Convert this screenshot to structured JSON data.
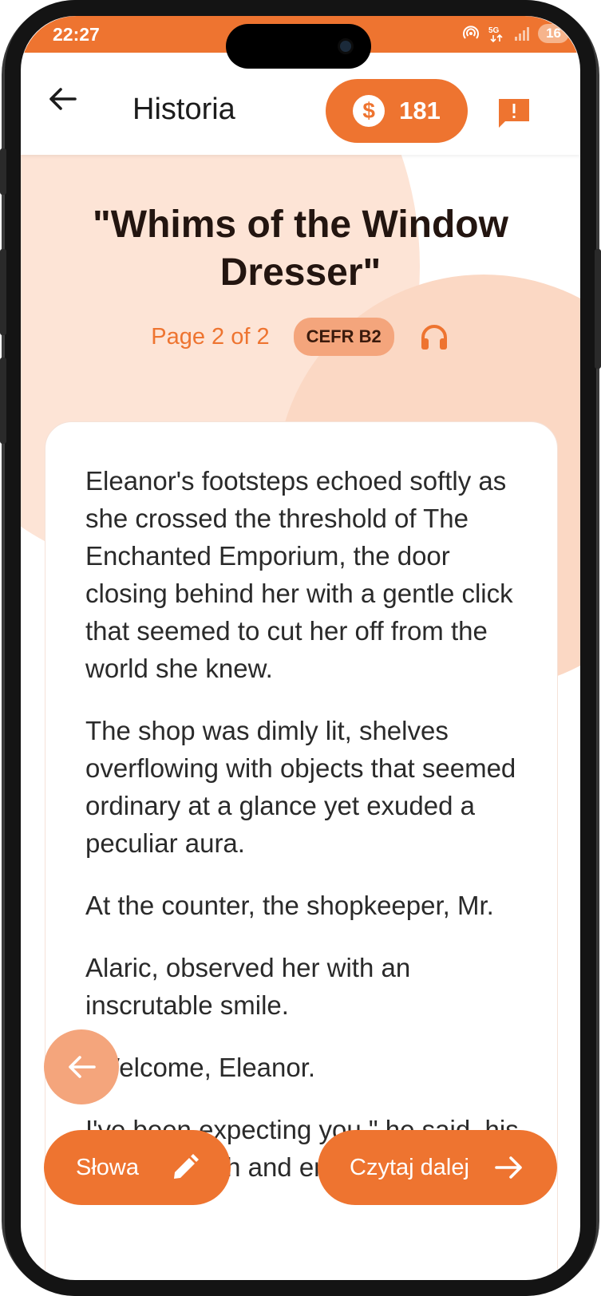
{
  "status_bar": {
    "time": "22:27",
    "battery": "16",
    "icons": [
      "hotspot-icon",
      "5g-icon",
      "signal-icon"
    ]
  },
  "app_bar": {
    "title": "Historia",
    "coins": "181",
    "back_icon": "arrow-left-icon",
    "coin_icon": "dollar-icon",
    "report_icon": "report-icon"
  },
  "story": {
    "title": "\"Whims of the Window Dresser\"",
    "page_info": "Page 2 of 2",
    "level": "CEFR B2",
    "audio_icon": "headphones-icon",
    "paragraphs": [
      "Eleanor's footsteps echoed softly as she crossed the threshold of The Enchanted Emporium, the door closing behind her with a gentle click that seemed to cut her off from the world she knew.",
      "The shop was dimly lit, shelves overflowing with objects that seemed ordinary at a glance yet exuded a peculiar aura.",
      "At the counter, the shopkeeper, Mr.",
      "Alaric, observed her with an inscrutable smile.",
      "\"Welcome, Eleanor.",
      "I've been expecting you,\" he said, his voice smooth and enigmatic."
    ]
  },
  "actions": {
    "prev_icon": "arrow-left-icon",
    "words_label": "Słowa",
    "words_icon": "pencil-icon",
    "next_label": "Czytaj dalej",
    "next_icon": "arrow-right-icon"
  },
  "colors": {
    "accent": "#ee7430",
    "accent_light": "#f4a57c",
    "background_tint": "#fde4d6"
  }
}
